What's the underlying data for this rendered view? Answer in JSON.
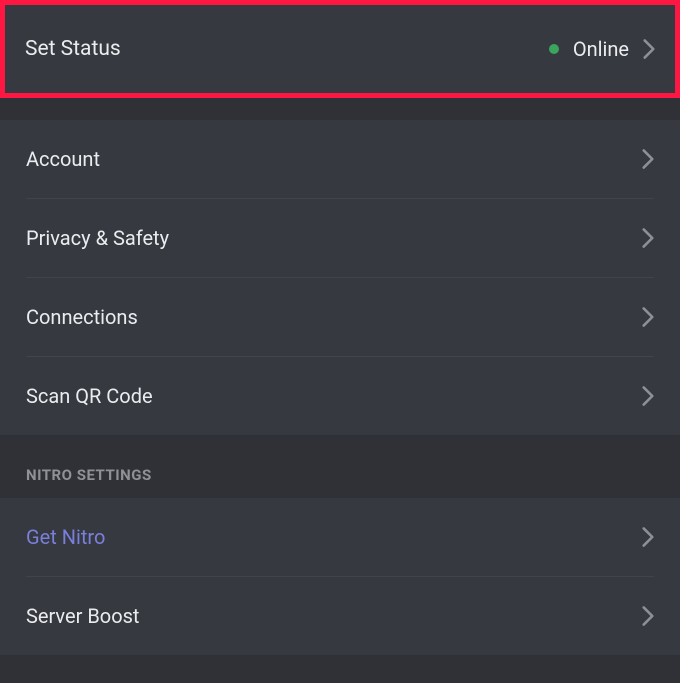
{
  "status": {
    "label": "Set Status",
    "value": "Online"
  },
  "userSettings": {
    "items": [
      {
        "label": "Account"
      },
      {
        "label": "Privacy & Safety"
      },
      {
        "label": "Connections"
      },
      {
        "label": "Scan QR Code"
      }
    ]
  },
  "nitroSettings": {
    "header": "NITRO SETTINGS",
    "items": [
      {
        "label": "Get Nitro",
        "accent": true
      },
      {
        "label": "Server Boost"
      }
    ]
  }
}
